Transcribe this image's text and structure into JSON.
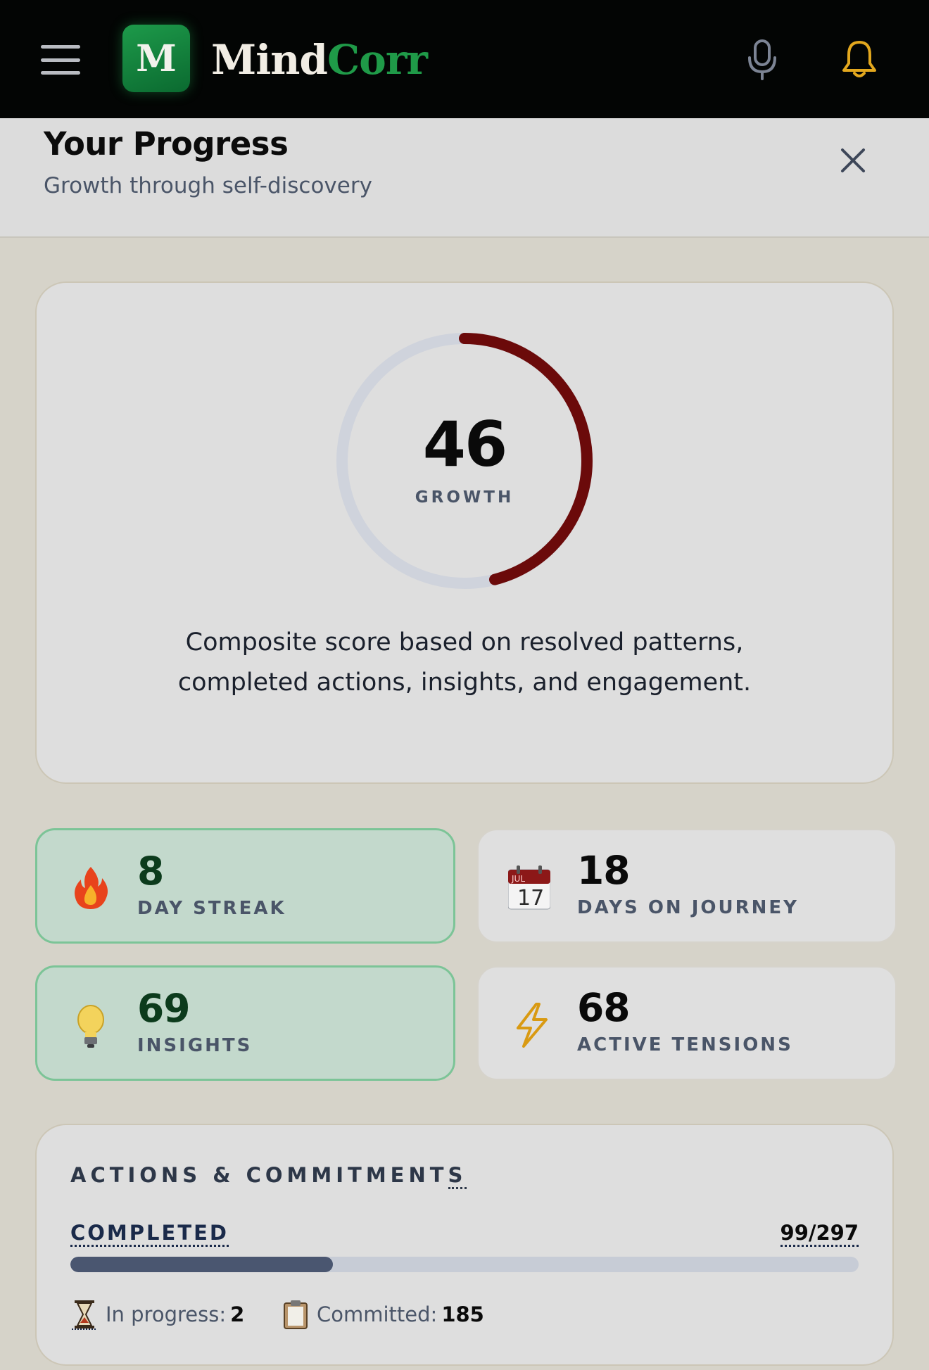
{
  "app": {
    "logo_letter": "M",
    "brand_part1": "Mind",
    "brand_part2": "Corr"
  },
  "header": {
    "title": "Your Progress",
    "subtitle": "Growth through self-discovery"
  },
  "growth": {
    "score": "46",
    "score_fraction": 0.46,
    "label": "GROWTH",
    "description": "Composite score based on resolved patterns, completed actions, insights, and engagement.",
    "ring_color": "#6b0a0a",
    "track_color": "#cfd3dc"
  },
  "stats": [
    {
      "value": "8",
      "label": "DAY STREAK",
      "icon": "fire-icon"
    },
    {
      "value": "18",
      "label": "DAYS ON JOURNEY",
      "icon": "calendar-icon",
      "calendar_month": "JUL",
      "calendar_day": "17"
    },
    {
      "value": "69",
      "label": "INSIGHTS",
      "icon": "lightbulb-icon"
    },
    {
      "value": "68",
      "label": "ACTIVE TENSIONS",
      "icon": "lightning-icon"
    }
  ],
  "actions": {
    "title_main": "ACTIONS & COMMITMENT",
    "title_last": "S",
    "completed_label": "COMPLETED",
    "completed_count": "99/297",
    "completed_fraction": 0.333,
    "in_progress_label": "In progress:",
    "in_progress_value": "2",
    "committed_label": "Committed:",
    "committed_value": "185"
  },
  "colors": {
    "accent_green": "#1f9a48",
    "topbar": "#030504",
    "progress_fill": "#4a5670",
    "bell": "#e3a81e"
  }
}
